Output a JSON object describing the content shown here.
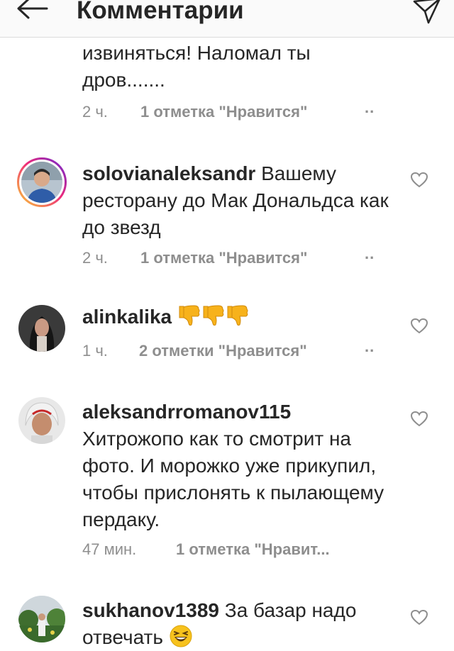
{
  "header": {
    "title": "Комментарии",
    "back_icon": "arrow-left-icon",
    "send_icon": "paper-plane-icon"
  },
  "comments": [
    {
      "username": "",
      "text_lines": [
        "извиняться! Наломал ты",
        "дров......."
      ],
      "time": "2 ч.",
      "likes": "1 отметка \"Нравится\"",
      "more": ".."
    },
    {
      "username": "solovianaleksandr",
      "text": "Вашему ресторану до Мак Дональдса как до звезд",
      "time": "2 ч.",
      "likes": "1 отметка \"Нравится\"",
      "more": ".."
    },
    {
      "username": "alinkalika",
      "text": "",
      "emoji": "thumbs-down-emoji x3",
      "time": "1 ч.",
      "likes": "2 отметки \"Нравится\"",
      "more": ".."
    },
    {
      "username": "aleksandrromanov115",
      "text": "Хитрожопо как то смотрит на фото. И морожко уже прикупил, чтобы прислонять к пылающему пердаку.",
      "time": "47 мин.",
      "likes": "1 отметка \"Нравит...",
      "more": ""
    },
    {
      "username": "sukhanov1389",
      "text": "За базар надо отвечать",
      "emoji": "laughing-emoji",
      "time": "",
      "likes": "",
      "more": ""
    }
  ],
  "colors": {
    "text": "#262626",
    "meta": "#8e8e8e",
    "divider": "#dbdbdb",
    "header_bg": "#fafafa"
  }
}
